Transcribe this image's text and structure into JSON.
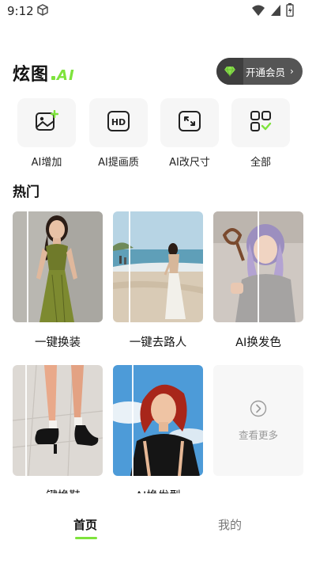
{
  "status_bar": {
    "time": "9:12",
    "icons": [
      "cube-icon",
      "wifi-icon",
      "signal-icon",
      "battery-icon"
    ]
  },
  "header": {
    "logo_text": "炫图",
    "logo_suffix": "AI",
    "vip_button": {
      "label": "开通会员",
      "icon": "diamond-icon"
    }
  },
  "tools": [
    {
      "label": "AI增加",
      "icon": "image-plus-icon"
    },
    {
      "label": "AI提画质",
      "icon": "hd-icon"
    },
    {
      "label": "AI改尺寸",
      "icon": "resize-icon"
    },
    {
      "label": "全部",
      "icon": "grid-icon"
    }
  ],
  "section": {
    "title": "热门"
  },
  "features": [
    {
      "label": "一键换装"
    },
    {
      "label": "一键去路人"
    },
    {
      "label": "AI换发色"
    },
    {
      "label": "一键换鞋"
    },
    {
      "label": "AI换发型"
    }
  ],
  "more": {
    "label": "查看更多"
  },
  "nav": {
    "home": "首页",
    "mine": "我的"
  },
  "colors": {
    "accent": "#7ee33c",
    "vip_bg": "#555555"
  }
}
